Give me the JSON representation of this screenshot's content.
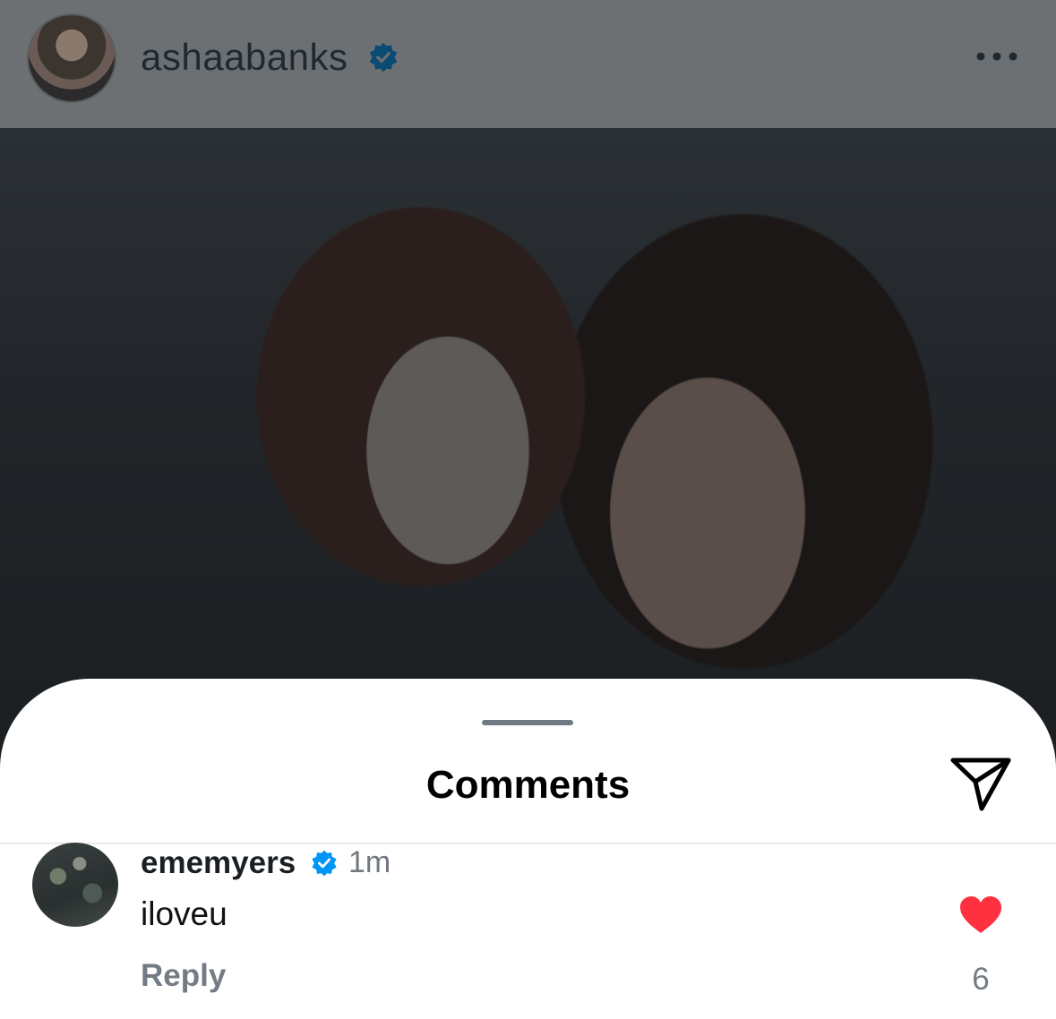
{
  "post": {
    "username": "ashaabanks"
  },
  "comments_sheet": {
    "title": "Comments"
  },
  "comment": {
    "username": "ememyers",
    "time": "1m",
    "text": "iloveu",
    "reply_label": "Reply",
    "like_count": "6"
  },
  "colors": {
    "verified": "#0095f6",
    "heart": "#ff3040",
    "header_overlay": "#6d7073"
  }
}
